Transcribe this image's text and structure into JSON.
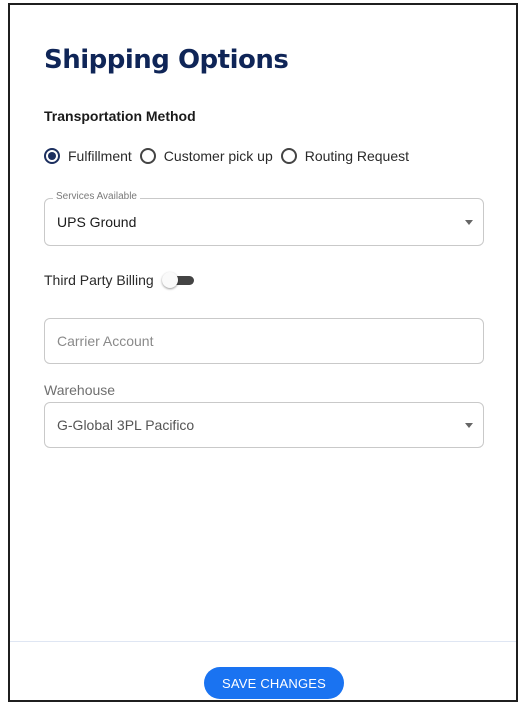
{
  "title": "Shipping Options",
  "transportation": {
    "label": "Transportation Method",
    "options": [
      {
        "label": "Fulfillment",
        "checked": true
      },
      {
        "label": "Customer pick up",
        "checked": false
      },
      {
        "label": "Routing Request",
        "checked": false
      }
    ]
  },
  "services": {
    "legend": "Services Available",
    "value": "UPS Ground"
  },
  "third_party_billing": {
    "label": "Third Party Billing",
    "enabled": false
  },
  "carrier_account": {
    "placeholder": "Carrier Account",
    "value": ""
  },
  "warehouse": {
    "label": "Warehouse",
    "value": "G-Global 3PL Pacifico"
  },
  "footer": {
    "save_label": "SAVE CHANGES"
  },
  "colors": {
    "title": "#0f2557",
    "radio_checked": "#1c2f5f",
    "primary_button": "#1a73f1"
  }
}
